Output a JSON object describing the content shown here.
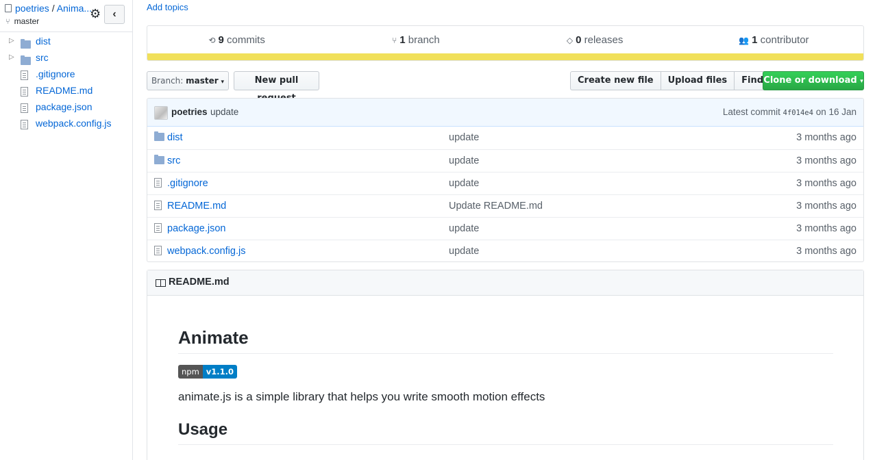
{
  "sidebar": {
    "repo_owner": "poetries",
    "repo_separator": " / ",
    "repo_name": "Anima...",
    "branch": "master",
    "toggle_icon": "‹",
    "tree": [
      {
        "name": "dist",
        "type": "folder"
      },
      {
        "name": "src",
        "type": "folder"
      },
      {
        "name": ".gitignore",
        "type": "file"
      },
      {
        "name": "README.md",
        "type": "file"
      },
      {
        "name": "package.json",
        "type": "file"
      },
      {
        "name": "webpack.config.js",
        "type": "file"
      }
    ]
  },
  "topics": {
    "add_label": "Add topics"
  },
  "summary": {
    "commits_count": "9",
    "commits_label": "commits",
    "branch_count": "1",
    "branch_label": "branch",
    "releases_count": "0",
    "releases_label": "releases",
    "contributor_count": "1",
    "contributor_label": "contributor",
    "language_color": "#f1e05a"
  },
  "toolbar": {
    "branch_prefix": "Branch:",
    "branch_value": "master",
    "new_pr": "New pull request",
    "create_file": "Create new file",
    "upload_files": "Upload files",
    "find_file": "Find file",
    "clone": "Clone or download"
  },
  "commit": {
    "author": "poetries",
    "message": "update",
    "latest_prefix": "Latest commit",
    "sha": "4f014e4",
    "date": "on 16 Jan"
  },
  "files": [
    {
      "name": "dist",
      "type": "folder",
      "message": "update",
      "age": "3 months ago"
    },
    {
      "name": "src",
      "type": "folder",
      "message": "update",
      "age": "3 months ago"
    },
    {
      "name": ".gitignore",
      "type": "file",
      "message": "update",
      "age": "3 months ago"
    },
    {
      "name": "README.md",
      "type": "file",
      "message": "Update README.md",
      "age": "3 months ago"
    },
    {
      "name": "package.json",
      "type": "file",
      "message": "update",
      "age": "3 months ago"
    },
    {
      "name": "webpack.config.js",
      "type": "file",
      "message": "update",
      "age": "3 months ago"
    }
  ],
  "readme": {
    "header": "README.md",
    "h1": "Animate",
    "badge_left": "npm",
    "badge_right": "v1.1.0",
    "description": "animate.js is a simple library that helps you write smooth motion effects",
    "h2": "Usage"
  }
}
